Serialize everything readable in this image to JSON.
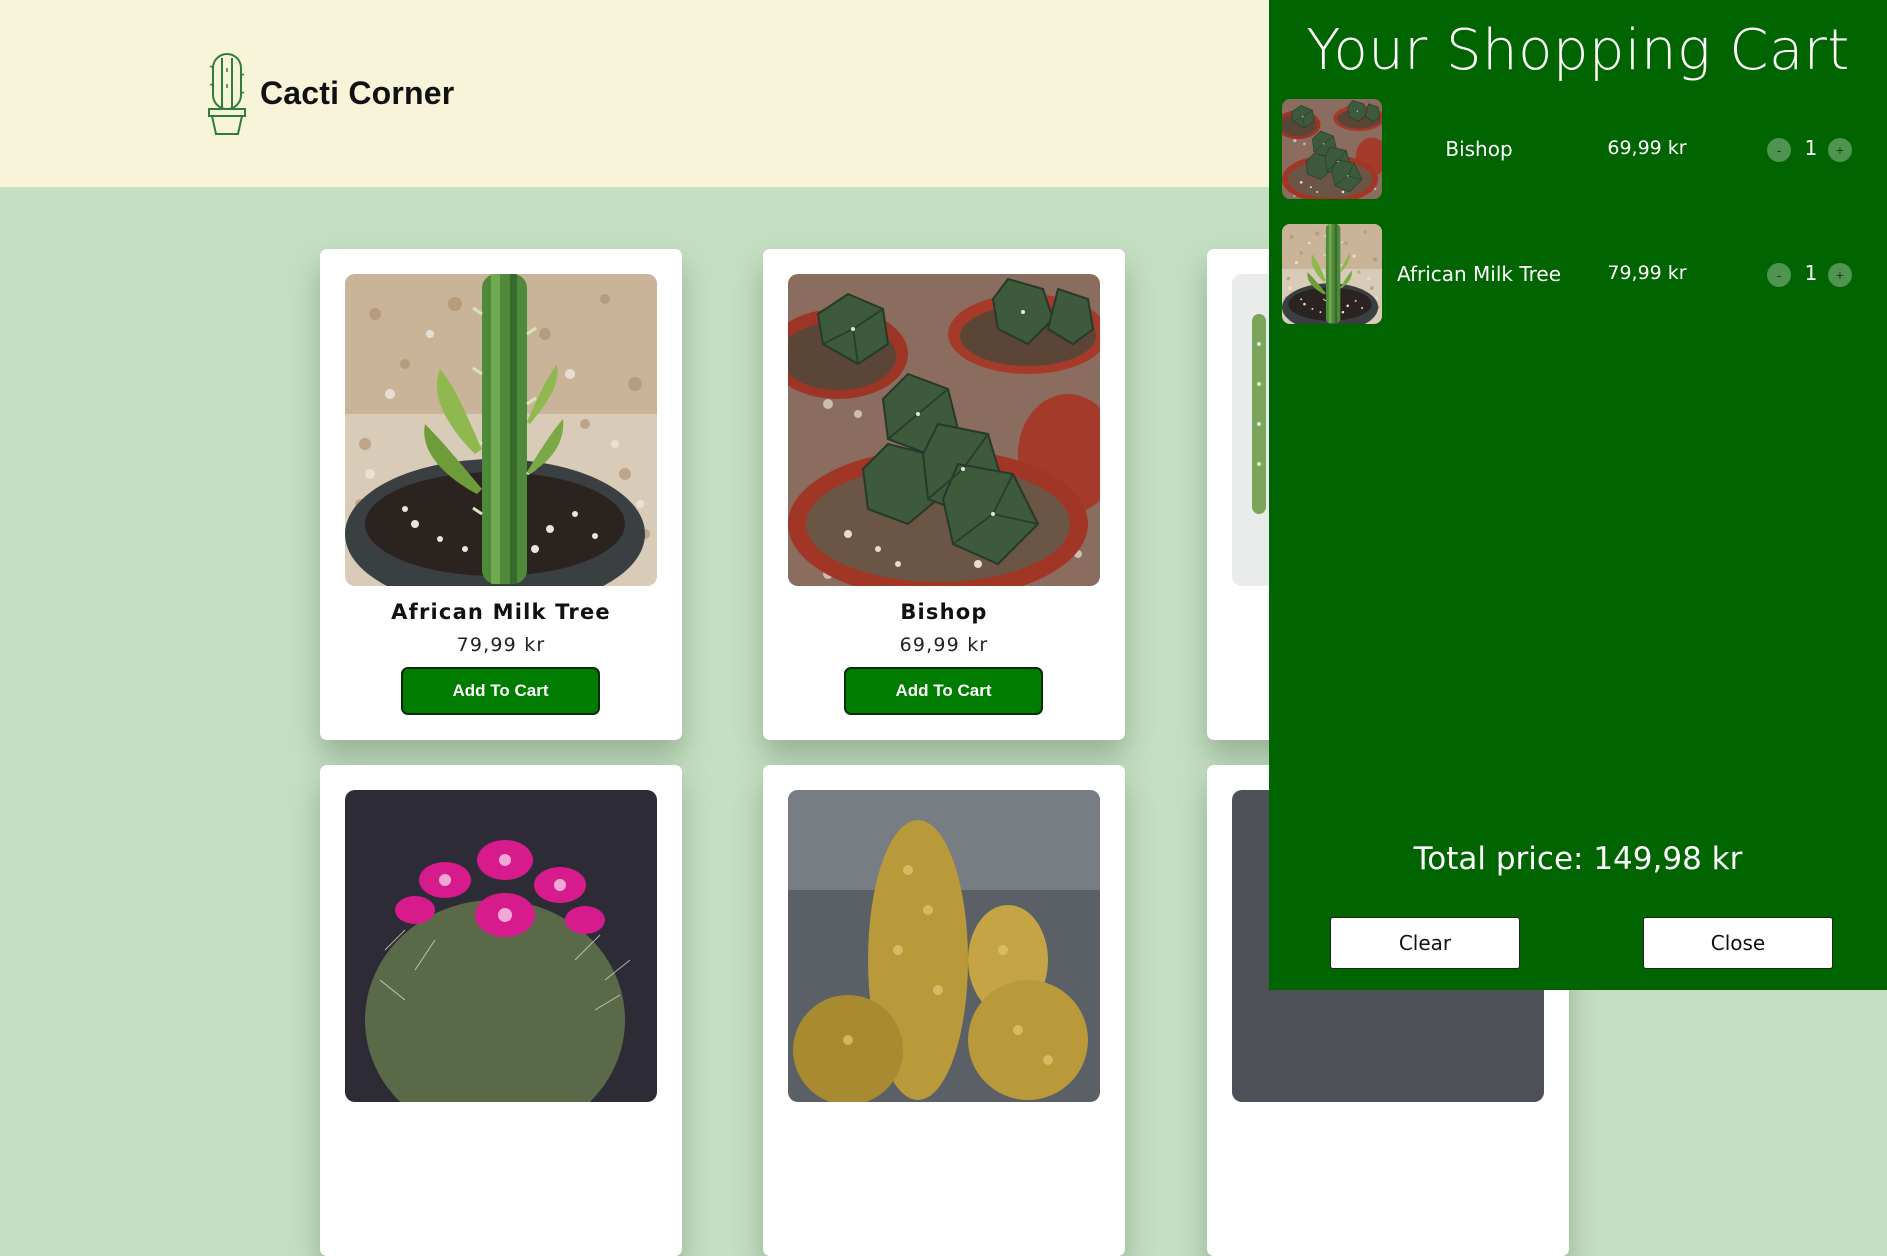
{
  "header": {
    "brand_name": "Cacti Corner",
    "logo_icon": "cactus-pot-icon"
  },
  "products": [
    {
      "name": "African Milk Tree",
      "price": "79,99 kr",
      "button": "Add To Cart"
    },
    {
      "name": "Bishop",
      "price": "69,99 kr",
      "button": "Add To Cart"
    }
  ],
  "cart": {
    "title": "Your Shopping Cart",
    "items": [
      {
        "name": "Bishop",
        "price": "69,99 kr",
        "quantity": "1",
        "minus": "-",
        "plus": "+"
      },
      {
        "name": "African Milk Tree",
        "price": "79,99 kr",
        "quantity": "1",
        "minus": "-",
        "plus": "+"
      }
    ],
    "total": "Total price: 149,98 kr",
    "clear_label": "Clear",
    "close_label": "Close"
  },
  "colors": {
    "cart_bg": "#006400",
    "page_bg": "#c5dfc3",
    "header_bg": "#f7f4da",
    "button_green": "#007c00"
  }
}
